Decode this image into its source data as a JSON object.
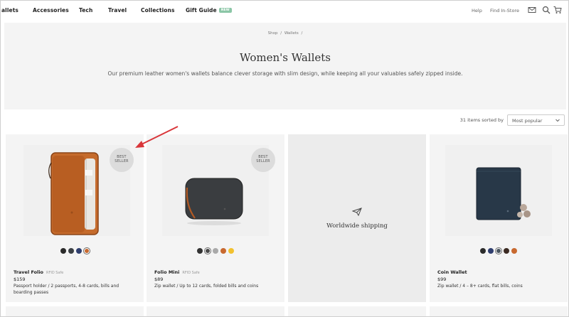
{
  "nav": {
    "items": [
      "allets",
      "Accessories",
      "Tech",
      "Travel",
      "Collections",
      "Gift Guide"
    ],
    "gift_badge": "NEW",
    "help": "Help",
    "find_in_store": "Find In-Store",
    "icons": [
      "mail-icon",
      "search-icon",
      "cart-icon"
    ]
  },
  "hero": {
    "breadcrumb": [
      "Shop",
      "/",
      "Wallets",
      "/"
    ],
    "title": "Women's Wallets",
    "description": "Our premium leather women's wallets balance clever storage with slim design, while keeping all your valuables safely zipped inside."
  },
  "sort": {
    "count_label": "31 items sorted by",
    "selected": "Most popular"
  },
  "products": [
    {
      "name": "Travel Folio",
      "tag": "RFID Safe",
      "price": "$159",
      "description": "Passport holder / 2 passports, 4-8 cards, bills and boarding passes",
      "badge": [
        "BEST",
        "SELLER"
      ],
      "swatches": [
        "#2a2a2a",
        "#3a3f44",
        "#2f3e6e",
        "#c8692f"
      ],
      "selected_swatch": 3
    },
    {
      "name": "Folio Mini",
      "tag": "RFID Safe",
      "price": "$89",
      "description": "Zip wallet / Up to 12 cards, folded bills and coins",
      "badge": [
        "BEST",
        "SELLER"
      ],
      "swatches": [
        "#333333",
        "#4a4a4a",
        "#a9a9a9",
        "#c8692f",
        "#f2c12e"
      ],
      "selected_swatch": 1
    },
    {
      "promo": "Worldwide shipping"
    },
    {
      "name": "Coin Wallet",
      "tag": "",
      "price": "$99",
      "description": "Zip wallet / 4 – 8+ cards, flat bills, coins",
      "swatches": [
        "#2b2b2b",
        "#2f3e6e",
        "#4a5560",
        "#3b2a22",
        "#c8692f"
      ],
      "selected_swatch": 2
    }
  ],
  "colors": {
    "hero_bg": "#f4f4f4",
    "card_bg": "#f4f4f4",
    "annotation_arrow": "#d9363a",
    "badge_new": "#8bc6a6"
  }
}
